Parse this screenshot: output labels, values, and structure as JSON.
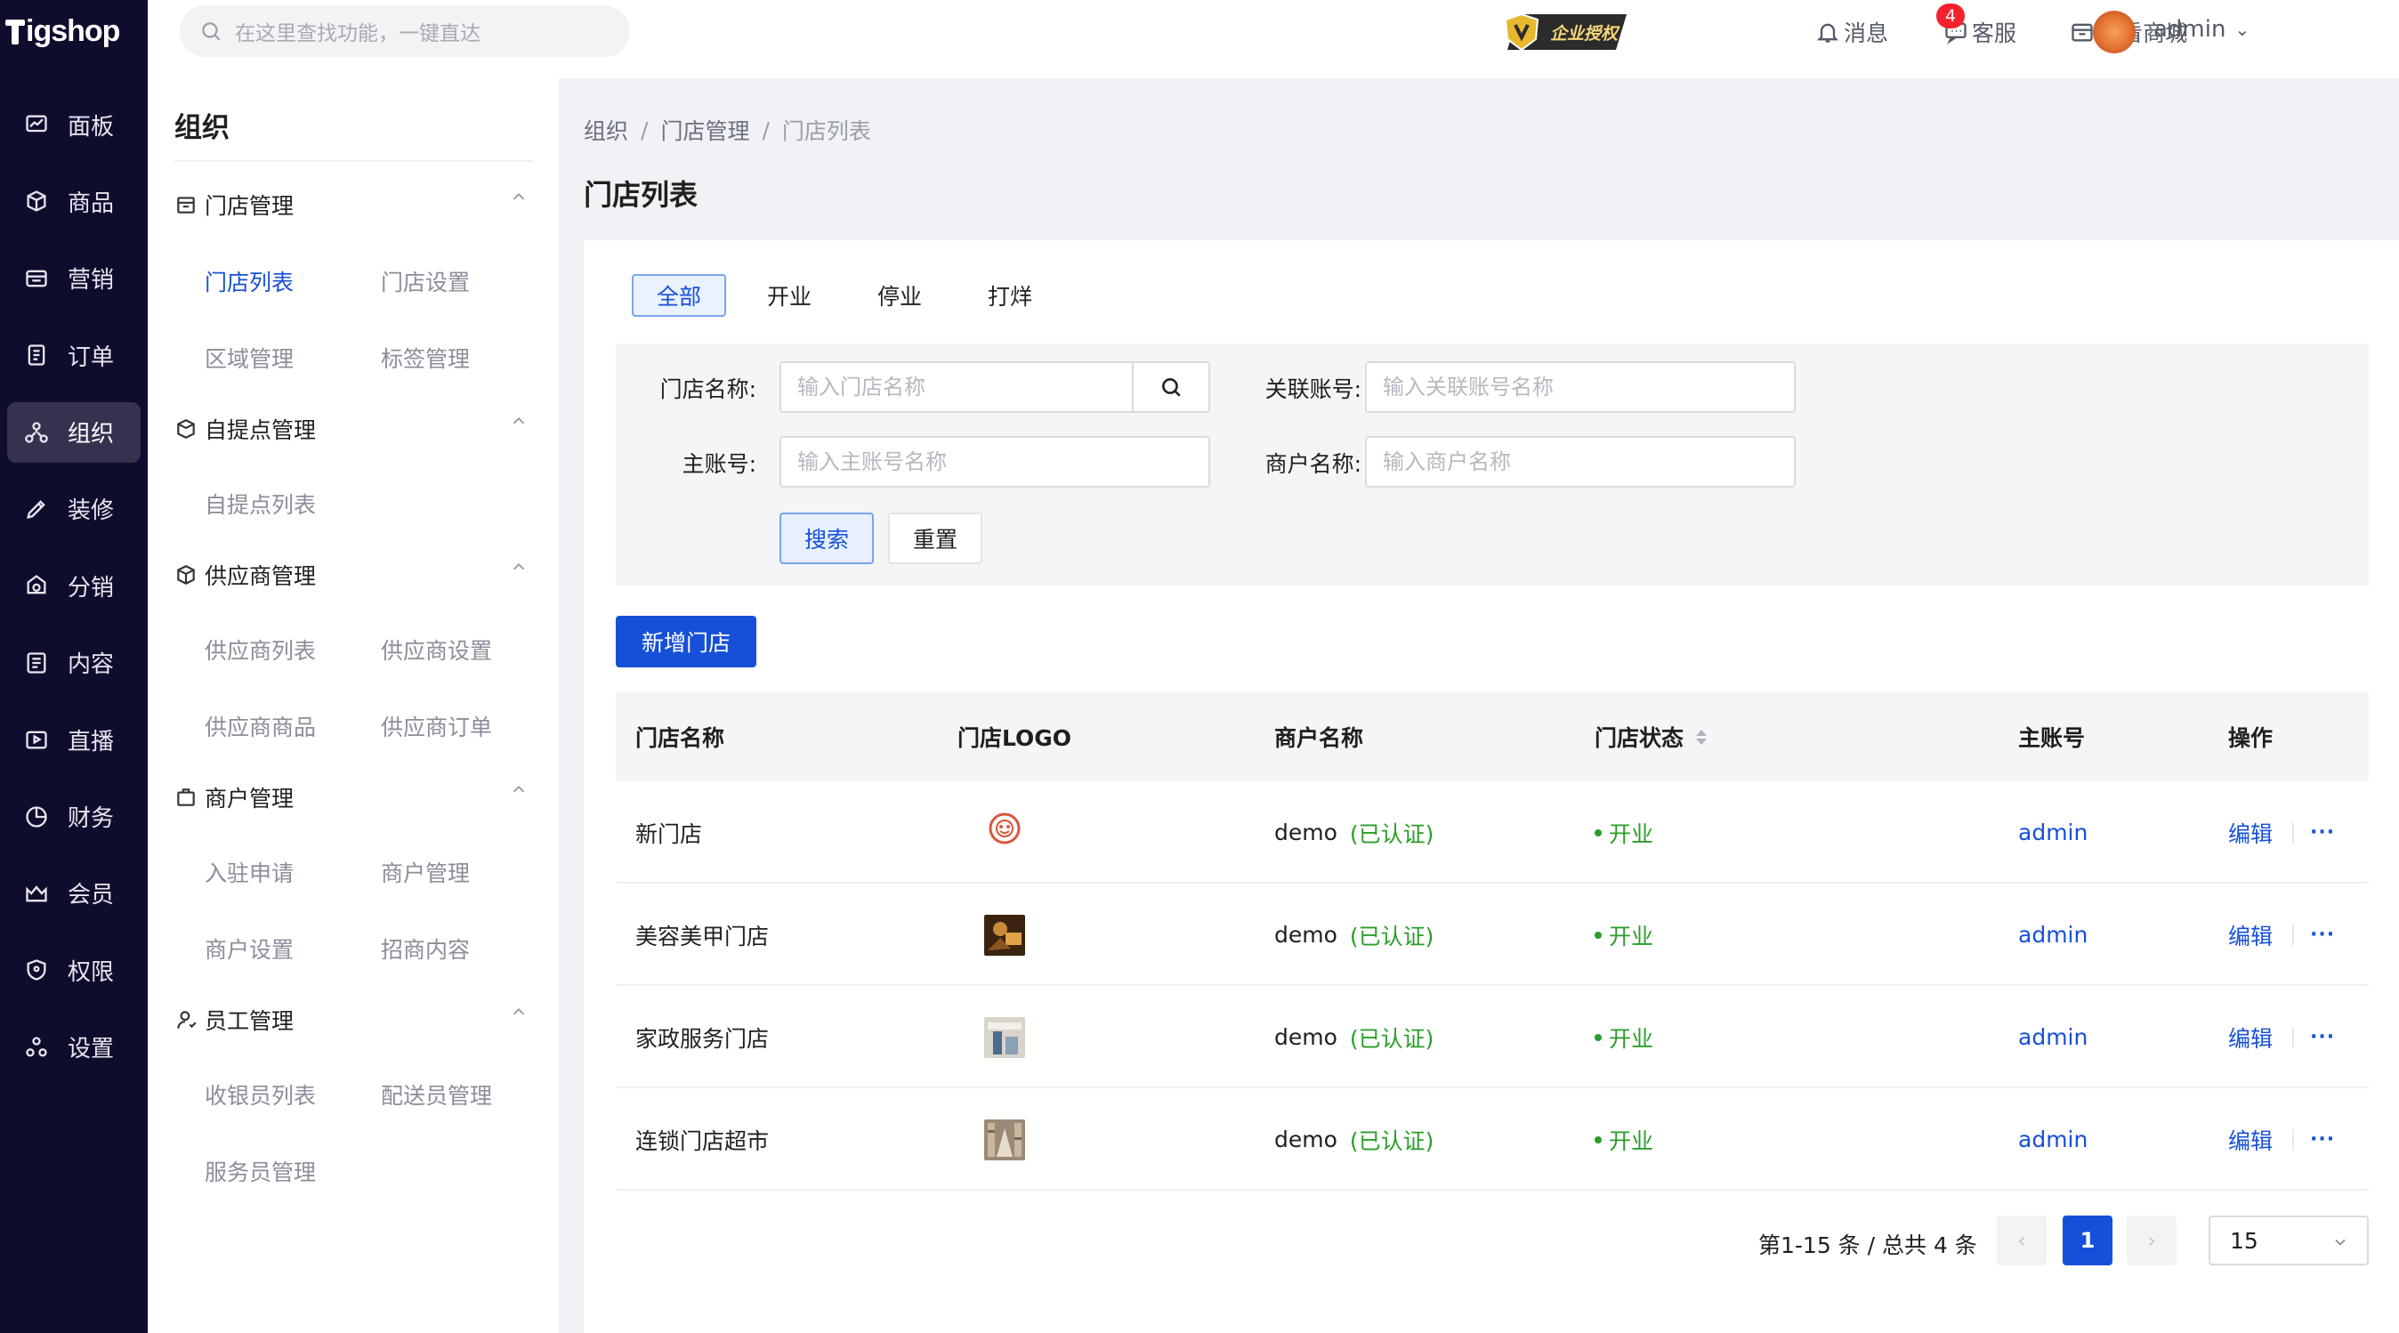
{
  "brand": {
    "name": "igshop"
  },
  "sidebar": {
    "items": [
      {
        "label": "面板",
        "icon": "dashboard-icon"
      },
      {
        "label": "商品",
        "icon": "cube-icon"
      },
      {
        "label": "营销",
        "icon": "marketing-icon"
      },
      {
        "label": "订单",
        "icon": "order-icon"
      },
      {
        "label": "组织",
        "icon": "organization-icon",
        "active": true
      },
      {
        "label": "装修",
        "icon": "decorate-icon"
      },
      {
        "label": "分销",
        "icon": "distribution-icon"
      },
      {
        "label": "内容",
        "icon": "content-icon"
      },
      {
        "label": "直播",
        "icon": "live-icon"
      },
      {
        "label": "财务",
        "icon": "finance-icon"
      },
      {
        "label": "会员",
        "icon": "member-icon"
      },
      {
        "label": "权限",
        "icon": "permission-icon"
      },
      {
        "label": "设置",
        "icon": "settings-icon"
      }
    ]
  },
  "topbar": {
    "search_placeholder": "在这里查找功能，一键直达",
    "auth_badge": "企业授权",
    "messages_label": "消息",
    "service_label": "客服",
    "service_count": "4",
    "view_shop_label": "查看商城",
    "user_name": "admin"
  },
  "submenu": {
    "title": "组织",
    "groups": [
      {
        "label": "门店管理",
        "items": [
          "门店列表",
          "门店设置",
          "区域管理",
          "标签管理"
        ]
      },
      {
        "label": "自提点管理",
        "items": [
          "自提点列表"
        ]
      },
      {
        "label": "供应商管理",
        "items": [
          "供应商列表",
          "供应商设置",
          "供应商商品",
          "供应商订单"
        ]
      },
      {
        "label": "商户管理",
        "items": [
          "入驻申请",
          "商户管理",
          "商户设置",
          "招商内容"
        ]
      },
      {
        "label": "员工管理",
        "items": [
          "收银员列表",
          "配送员管理",
          "服务员管理"
        ]
      }
    ]
  },
  "breadcrumb": {
    "items": [
      "组织",
      "门店管理",
      "门店列表"
    ]
  },
  "page_title": "门店列表",
  "tabs": [
    "全部",
    "开业",
    "停业",
    "打烊"
  ],
  "filter": {
    "store_name_label": "门店名称:",
    "store_name_placeholder": "输入门店名称",
    "linked_account_label": "关联账号:",
    "linked_account_placeholder": "输入关联账号名称",
    "main_account_label": "主账号:",
    "main_account_placeholder": "输入主账号名称",
    "merchant_name_label": "商户名称:",
    "merchant_name_placeholder": "输入商户名称",
    "search_button": "搜索",
    "reset_button": "重置"
  },
  "add_button": "新增门店",
  "table": {
    "columns": [
      "门店名称",
      "门店LOGO",
      "商户名称",
      "门店状态",
      "主账号",
      "操作"
    ],
    "rows": [
      {
        "name": "新门店",
        "merchant": "demo",
        "verified": "(已认证)",
        "status": "开业",
        "account": "admin",
        "edit": "编辑",
        "more": "···"
      },
      {
        "name": "美容美甲门店",
        "merchant": "demo",
        "verified": "(已认证)",
        "status": "开业",
        "account": "admin",
        "edit": "编辑",
        "more": "···"
      },
      {
        "name": "家政服务门店",
        "merchant": "demo",
        "verified": "(已认证)",
        "status": "开业",
        "account": "admin",
        "edit": "编辑",
        "more": "···"
      },
      {
        "name": "连锁门店超市",
        "merchant": "demo",
        "verified": "(已认证)",
        "status": "开业",
        "account": "admin",
        "edit": "编辑",
        "more": "···"
      }
    ]
  },
  "pagination": {
    "summary": "第1-15 条 / 总共 4 条",
    "current_page": "1",
    "page_size": "15",
    "prev_glyph": "‹",
    "next_glyph": "›"
  },
  "colors": {
    "primary": "#1650d8",
    "sidebar_bg": "#0f0d2e",
    "success": "#2a9d2a"
  }
}
